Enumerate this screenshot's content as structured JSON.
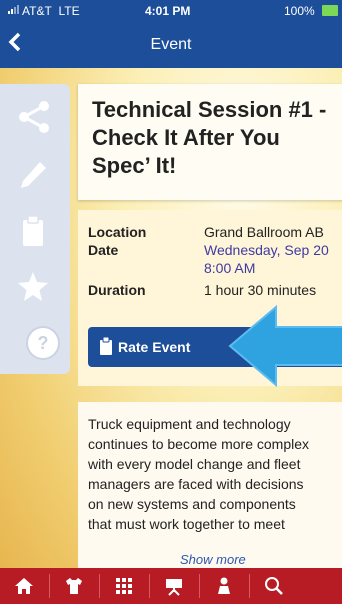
{
  "status": {
    "carrier": "AT&T",
    "network": "LTE",
    "time": "4:01 PM",
    "battery": "100%"
  },
  "nav": {
    "back_icon": "chevron-left-icon",
    "title": "Event"
  },
  "rail": {
    "items": [
      {
        "name": "share",
        "icon": "share-icon"
      },
      {
        "name": "edit",
        "icon": "pencil-icon"
      },
      {
        "name": "notes",
        "icon": "clipboard-icon"
      },
      {
        "name": "favorite",
        "icon": "star-icon"
      },
      {
        "name": "help",
        "icon": "question-icon",
        "label": "?"
      }
    ]
  },
  "event": {
    "title_line1": "Technical Session #1 -",
    "title_line2": "Check It After You",
    "title_line3": "Spec’ It!",
    "location_label": "Location",
    "location_value": "Grand Ballroom AB",
    "date_label": "Date",
    "date_value": "Wednesday, Sep 20",
    "time_value": "8:00 AM",
    "duration_label": "Duration",
    "duration_value": "1 hour 30 minutes",
    "rate_button": "Rate Event",
    "description_lines": [
      "Truck equipment and technology",
      "continues to become more complex",
      "with every model change and fleet",
      "managers are faced with decisions",
      "on new systems and components",
      "that must work together to meet"
    ],
    "show_more": "Show more"
  },
  "tabbar": {
    "items": [
      {
        "name": "home",
        "icon": "home-icon"
      },
      {
        "name": "exhibitors",
        "icon": "shirt-icon"
      },
      {
        "name": "menu",
        "icon": "grid-icon"
      },
      {
        "name": "sessions",
        "icon": "presentation-icon"
      },
      {
        "name": "attendees",
        "icon": "people-icon"
      },
      {
        "name": "search",
        "icon": "search-icon"
      }
    ]
  },
  "colors": {
    "nav_blue": "#1c4e9a",
    "tab_red": "#b71c25",
    "arrow_blue": "#2fa3e0",
    "date_purple": "#3f3aa0"
  }
}
